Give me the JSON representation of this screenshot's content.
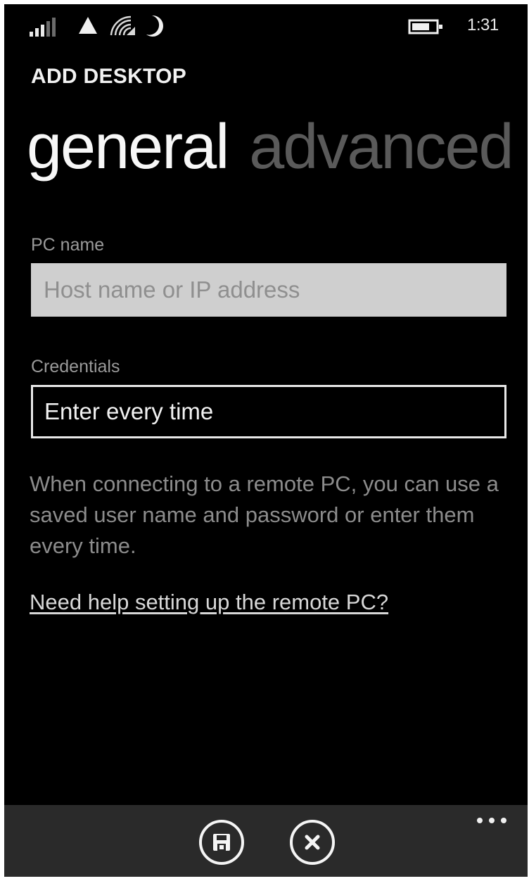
{
  "status_bar": {
    "time": "1:31",
    "icons": [
      "signal-icon",
      "network-triangle-icon",
      "wifi-icon",
      "quiet-hours-moon-icon",
      "battery-icon"
    ]
  },
  "header": {
    "app_title": "ADD DESKTOP",
    "pivots": [
      {
        "label": "general",
        "active": true
      },
      {
        "label": "advanced",
        "active": false
      }
    ]
  },
  "form": {
    "pc_name": {
      "label": "PC name",
      "placeholder": "Host name or IP address",
      "value": ""
    },
    "credentials": {
      "label": "Credentials",
      "value": "Enter every time"
    },
    "help_text": "When connecting to a remote PC, you can use a saved user name and password or enter them every time.",
    "help_link": "Need help setting up the remote PC?"
  },
  "app_bar": {
    "buttons": [
      {
        "icon": "save-icon"
      },
      {
        "icon": "cancel-icon"
      }
    ],
    "more": "more-icon"
  },
  "colors": {
    "background": "#000000",
    "app_bar": "#2a2a2a",
    "input_fill": "#cfcfcf",
    "inactive_text": "#5a5a5a",
    "secondary_text": "#8c8c8c"
  }
}
